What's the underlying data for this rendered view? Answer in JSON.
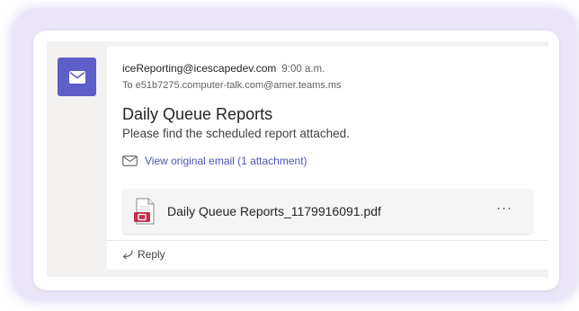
{
  "message": {
    "sender": "iceReporting@icescapedev.com",
    "time": "9:00 a.m.",
    "to": "To e51b7275.computer-talk.com@amer.teams.ms",
    "subject": "Daily Queue Reports",
    "body": "Please find the scheduled report attached.",
    "view_original": "View original email (1 attachment)"
  },
  "attachment": {
    "file_name": "Daily Queue Reports_1179916091.pdf",
    "more_label": "···"
  },
  "reply": {
    "label": "Reply"
  },
  "colors": {
    "accent": "#5b5fc7",
    "link": "#4f52b2",
    "pdf_red": "#c4314b"
  },
  "icons": {
    "avatar": "mail-icon",
    "view_original": "envelope-outline-icon",
    "attachment": "pdf-file-icon",
    "reply": "reply-arrow-icon"
  }
}
